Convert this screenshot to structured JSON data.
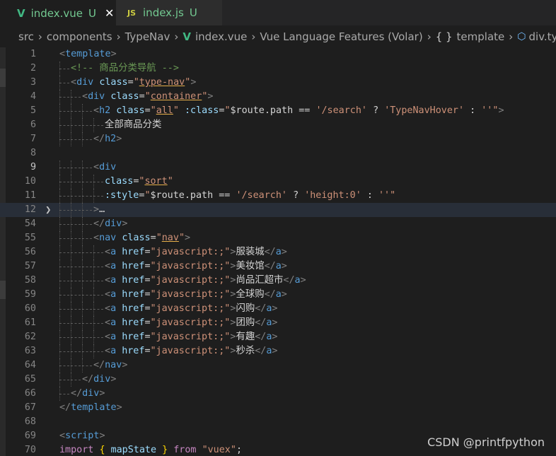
{
  "tabs": [
    {
      "icon": "vue-icon",
      "name": "index.vue",
      "status": "U",
      "active": true,
      "close": "✕"
    },
    {
      "icon": "js-icon",
      "icon_text": "JS",
      "name": "index.js",
      "status": "U",
      "active": false
    }
  ],
  "breadcrumb": {
    "items": [
      "src",
      "components",
      "TypeNav",
      "index.vue",
      "Vue Language Features (Volar)",
      "template",
      "div.typ"
    ],
    "brace": "{ }"
  },
  "watermark": "CSDN @printfpython",
  "lines": [
    {
      "n": "1",
      "html": "<span class='t-br'>&lt;</span><span class='t-tag'>template</span><span class='t-br'>&gt;</span>"
    },
    {
      "n": "2",
      "html": "G1<span class='t-comment'>&lt;!-- 商品分类导航 --&gt;</span>"
    },
    {
      "n": "3",
      "html": "G1<span class='t-br'>&lt;</span><span class='t-tag'>div</span> <span class='t-attr'>class</span><span class='t-punct'>=</span><span class='t-str'>\"<span class='ul'>type-nav</span>\"</span><span class='t-br'>&gt;</span>"
    },
    {
      "n": "4",
      "html": "G2<span class='t-br'>&lt;</span><span class='t-tag'>div</span> <span class='t-attr'>class</span><span class='t-punct'>=</span><span class='t-str'>\"<span class='ul'>container</span>\"</span><span class='t-br'>&gt;</span>"
    },
    {
      "n": "5",
      "html": "G3<span class='t-br'>&lt;</span><span class='t-tag'>h2</span> <span class='t-attr'>class</span><span class='t-punct'>=</span><span class='t-str'>\"<span class='ul'>all</span>\"</span> <span class='t-attr'>:class</span><span class='t-punct'>=</span><span class='t-str'>\"</span><span class='t-text'>$route.path</span> <span class='t-punct'>==</span> <span class='t-str'>'/search'</span> <span class='t-punct'>?</span> <span class='t-str'>'TypeNavHover'</span> <span class='t-punct'>:</span> <span class='t-str'>''\"</span><span class='t-br'>&gt;</span>"
    },
    {
      "n": "6",
      "html": "G4<span class='t-text'>全部商品分类</span>"
    },
    {
      "n": "7",
      "html": "G3<span class='t-br'>&lt;/</span><span class='t-tag'>h2</span><span class='t-br'>&gt;</span>"
    },
    {
      "n": "8",
      "html": ""
    },
    {
      "n": "9",
      "html": "G3<span class='t-br'>&lt;</span><span class='t-tag'>div</span>"
    },
    {
      "n": "10",
      "html": "G4<span class='t-attr'>class</span><span class='t-punct'>=</span><span class='t-str'>\"<span class='ul'>sort</span>\"</span>"
    },
    {
      "n": "11",
      "html": "G4<span class='t-attr'>:style</span><span class='t-punct'>=</span><span class='t-str'>\"</span><span class='t-text'>$route.path</span> <span class='t-punct'>==</span> <span class='t-str'>'/search'</span> <span class='t-punct'>?</span> <span class='t-str'>'height:0'</span> <span class='t-punct'>:</span> <span class='t-str'>''\"</span>"
    },
    {
      "n": "12",
      "html": "G3<span class='t-br'>&gt;</span><span class='t-text'>…</span>",
      "hl": true,
      "fold": "❯"
    },
    {
      "n": "54",
      "html": "G3<span class='t-br'>&lt;/</span><span class='t-tag'>div</span><span class='t-br'>&gt;</span>"
    },
    {
      "n": "55",
      "html": "G3<span class='t-br'>&lt;</span><span class='t-tag'>nav</span> <span class='t-attr'>class</span><span class='t-punct'>=</span><span class='t-str'>\"<span class='ul'>nav</span>\"</span><span class='t-br'>&gt;</span>"
    },
    {
      "n": "56",
      "html": "G4<span class='t-br'>&lt;</span><span class='t-tag'>a</span> <span class='t-attr'>href</span><span class='t-punct'>=</span><span class='t-str'>\"javascript:;\"</span><span class='t-br'>&gt;</span><span class='t-text'>服装城</span><span class='t-br'>&lt;/</span><span class='t-tag'>a</span><span class='t-br'>&gt;</span>"
    },
    {
      "n": "57",
      "html": "G4<span class='t-br'>&lt;</span><span class='t-tag'>a</span> <span class='t-attr'>href</span><span class='t-punct'>=</span><span class='t-str'>\"javascript:;\"</span><span class='t-br'>&gt;</span><span class='t-text'>美妆馆</span><span class='t-br'>&lt;/</span><span class='t-tag'>a</span><span class='t-br'>&gt;</span>"
    },
    {
      "n": "58",
      "html": "G4<span class='t-br'>&lt;</span><span class='t-tag'>a</span> <span class='t-attr'>href</span><span class='t-punct'>=</span><span class='t-str'>\"javascript:;\"</span><span class='t-br'>&gt;</span><span class='t-text'>尚品汇超市</span><span class='t-br'>&lt;/</span><span class='t-tag'>a</span><span class='t-br'>&gt;</span>"
    },
    {
      "n": "59",
      "html": "G4<span class='t-br'>&lt;</span><span class='t-tag'>a</span> <span class='t-attr'>href</span><span class='t-punct'>=</span><span class='t-str'>\"javascript:;\"</span><span class='t-br'>&gt;</span><span class='t-text'>全球购</span><span class='t-br'>&lt;/</span><span class='t-tag'>a</span><span class='t-br'>&gt;</span>"
    },
    {
      "n": "60",
      "html": "G4<span class='t-br'>&lt;</span><span class='t-tag'>a</span> <span class='t-attr'>href</span><span class='t-punct'>=</span><span class='t-str'>\"javascript:;\"</span><span class='t-br'>&gt;</span><span class='t-text'>闪购</span><span class='t-br'>&lt;/</span><span class='t-tag'>a</span><span class='t-br'>&gt;</span>"
    },
    {
      "n": "61",
      "html": "G4<span class='t-br'>&lt;</span><span class='t-tag'>a</span> <span class='t-attr'>href</span><span class='t-punct'>=</span><span class='t-str'>\"javascript:;\"</span><span class='t-br'>&gt;</span><span class='t-text'>团购</span><span class='t-br'>&lt;/</span><span class='t-tag'>a</span><span class='t-br'>&gt;</span>"
    },
    {
      "n": "62",
      "html": "G4<span class='t-br'>&lt;</span><span class='t-tag'>a</span> <span class='t-attr'>href</span><span class='t-punct'>=</span><span class='t-str'>\"javascript:;\"</span><span class='t-br'>&gt;</span><span class='t-text'>有趣</span><span class='t-br'>&lt;/</span><span class='t-tag'>a</span><span class='t-br'>&gt;</span>"
    },
    {
      "n": "63",
      "html": "G4<span class='t-br'>&lt;</span><span class='t-tag'>a</span> <span class='t-attr'>href</span><span class='t-punct'>=</span><span class='t-str'>\"javascript:;\"</span><span class='t-br'>&gt;</span><span class='t-text'>秒杀</span><span class='t-br'>&lt;/</span><span class='t-tag'>a</span><span class='t-br'>&gt;</span>"
    },
    {
      "n": "64",
      "html": "G3<span class='t-br'>&lt;/</span><span class='t-tag'>nav</span><span class='t-br'>&gt;</span>"
    },
    {
      "n": "65",
      "html": "G2<span class='t-br'>&lt;/</span><span class='t-tag'>div</span><span class='t-br'>&gt;</span>"
    },
    {
      "n": "66",
      "html": "G1<span class='t-br'>&lt;/</span><span class='t-tag'>div</span><span class='t-br'>&gt;</span>"
    },
    {
      "n": "67",
      "html": "<span class='t-br'>&lt;/</span><span class='t-tag'>template</span><span class='t-br'>&gt;</span>"
    },
    {
      "n": "68",
      "html": ""
    },
    {
      "n": "69",
      "html": "<span class='t-br'>&lt;</span><span class='t-tag'>script</span><span class='t-br'>&gt;</span>"
    },
    {
      "n": "70",
      "html": "<span class='t-kw'>import</span> <span class='t-brace'>{</span> <span class='t-var'>mapState</span> <span class='t-brace'>}</span> <span class='t-kw'>from</span> <span class='t-str'>\"vuex\"</span><span class='t-punct'>;</span>"
    }
  ]
}
